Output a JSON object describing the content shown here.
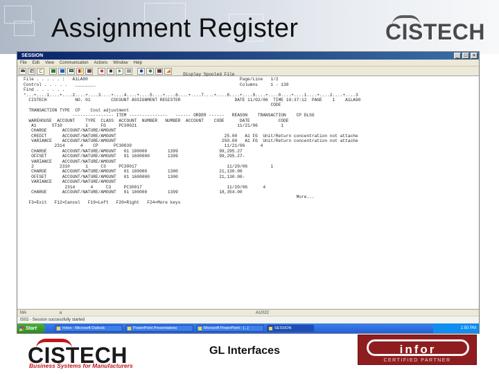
{
  "slide": {
    "title": "Assignment Register",
    "header_logo": "CISTECH",
    "footer_text": "GL Interfaces",
    "footer_logo": "CISTECH",
    "footer_tagline": "Business Systems for Manufacturers",
    "partner_badge": {
      "name": "infor",
      "sub": "CERTIFIED PARTNER"
    }
  },
  "window": {
    "title": "SESSION",
    "controls": [
      "_",
      "□",
      "×"
    ],
    "menu": [
      "File",
      "Edit",
      "View",
      "Communication",
      "Actions",
      "Window",
      "Help"
    ],
    "toolbar_icons": [
      "print-icon",
      "copy-icon",
      "paste-icon",
      "send-icon",
      "receive-icon",
      "display-icon",
      "color-icon",
      "map-icon",
      "record-icon",
      "stop-icon",
      "play-icon",
      "clear-icon",
      "macro-icon",
      "support-icon",
      "index-icon",
      "help-icon"
    ]
  },
  "spool": {
    "lines": [
      "                                                              Display Spooled File",
      "File . . . . . :   A1LA90                                                           Page/Line   1/2",
      "Control . . . . .   ________                                                        Columns     1 - 130",
      "Find . . . . . .",
      "*...+....1....+....2....+....3....+....4....+....5....+....6....+....7....+....8....+....9....+....0....+....1....+....2....+....3",
      "  CISTECH           NO. 01        COCOUNT ASSIGNMENT REGISTER                     DATE 11/02/06  TIME 10:37:12  PAGE    1    A1LA90",
      "                                                                                                CODE",
      "  TRANSACTION TYPE  CP    Cost adjustment",
      "                   ---------------- ITEM ---------------   ------ ORDER ------   REASON    TRANSACTION    CP DLSG",
      "  WAREHOUSE  ACCOUNT    TYPE  CLASS  ACCOUNT  NUMBER   NUMBER  ACCOUNT    CODE      DATE           CODE",
      "   A1      ST10         1     FG     PC30021                                       11/21/06         1",
      "   CHARGE      ACCOUNT/NATURE/AMOUNT",
      "   CREDIT      ACCOUNT/NATURE/AMOUNT                                          25.00   A1 FG  Unit/Return concentration not attache",
      "   VARIANCE    ACCOUNT/NATURE/AMOUNT                                         250.00   A1 FG  Unit/Return concentration not attache",
      "            2314      4    CP      PC30039                                    11/21/06      4",
      "   CHARGE      ACCOUNT/NATURE/AMOUNT   01 100000        1399                99,295.27",
      "   OFFSET      ACCOUNT/NATURE/AMOUNT   01 1600000       1399                99,295.27-",
      "   VARIANCE    ACCOUNT/NATURE/AMOUNT",
      "   2          2310      1     C3     PC30017                                   11/20/06         1",
      "   CHARGE      ACCOUNT/NATURE/AMOUNT   01 100000        1300                21,130.00",
      "   OFFSET      ACCOUNT/NATURE/AMOUNT   01 1600000       1300                21,130.00-",
      "   VARIANCE    ACCOUNT/NATURE/AMOUNT",
      "                2314      4     C3     PC30017                                 11/20/06      4",
      "   CHARGE      ACCOUNT/NATURE/AMOUNT   01 100000        1399                18,354.00",
      "                                                                                                          More...",
      "  F3=Exit   F12=Cancel   F19=Left   F20=Right   F24=More keys"
    ]
  },
  "status": {
    "position": "MA",
    "field": "a",
    "sys": "A1/022",
    "message": "IS02 - Session successfully started"
  },
  "taskbar": {
    "start_label": "Start",
    "items": [
      "Inbox - Microsoft Outlook",
      "PowerPoint Presentations",
      "Microsoft PowerPoint - [...]",
      "SESSION"
    ],
    "clock": "1:50 PM"
  }
}
